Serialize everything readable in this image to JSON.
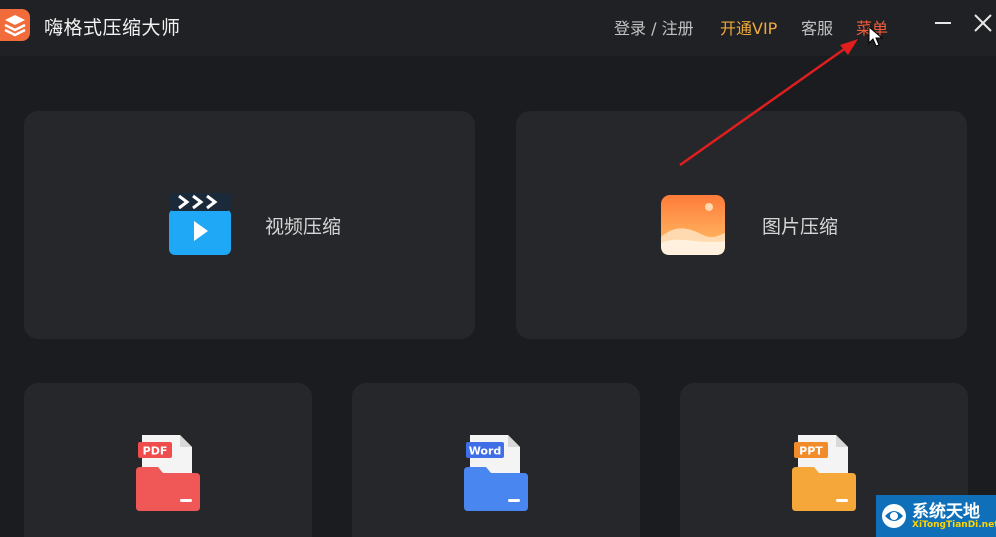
{
  "app": {
    "title": "嗨格式压缩大师",
    "icon": "layers-icon",
    "accent": "#f26b3a"
  },
  "header": {
    "login_label": "登录 / 注册",
    "vip_label": "开通VIP",
    "service_label": "客服",
    "menu_label": "菜单",
    "vip_color": "#f0a93a",
    "menu_color": "#f25a3a"
  },
  "cards": {
    "video": {
      "label": "视频压缩",
      "icon": "video-clapper-icon"
    },
    "image": {
      "label": "图片压缩",
      "icon": "landscape-image-icon"
    },
    "pdf": {
      "badge": "PDF",
      "icon": "pdf-folder-icon"
    },
    "word": {
      "badge": "Word",
      "icon": "word-folder-icon"
    },
    "ppt": {
      "badge": "PPT",
      "icon": "ppt-folder-icon"
    }
  },
  "watermark": {
    "title": "系统天地",
    "subtitle": "XiTongTianDi.net"
  }
}
